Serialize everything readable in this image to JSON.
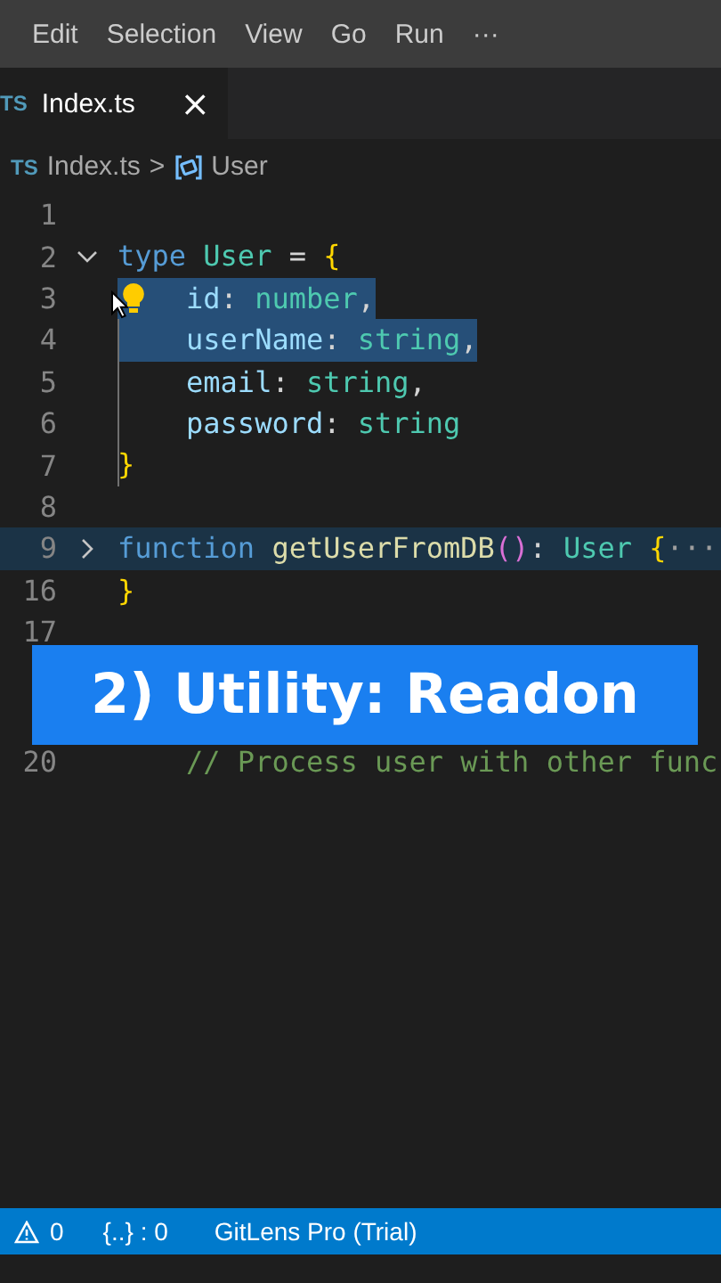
{
  "menu": {
    "items": [
      {
        "label": "Edit"
      },
      {
        "label": "Selection"
      },
      {
        "label": "View"
      },
      {
        "label": "Go"
      },
      {
        "label": "Run"
      }
    ],
    "more": "···"
  },
  "tabs": [
    {
      "icon": "TS",
      "label": "Index.ts",
      "close": "×",
      "selected": true
    }
  ],
  "breadcrumbs": {
    "file_icon": "TS",
    "file": "Index.ts",
    "separator": ">",
    "symbol": "User"
  },
  "editor": {
    "lines": [
      {
        "number": "1",
        "selected": false,
        "lightbulb": false
      },
      {
        "number": "2",
        "expanded": true,
        "selected": false,
        "lightbulb": false,
        "tokens": [
          {
            "kind": "keyword",
            "text": "type"
          },
          {
            "kind": "type",
            "text": " User"
          },
          {
            "kind": "plain",
            "text": " = "
          },
          {
            "kind": "brace",
            "text": "{"
          }
        ]
      },
      {
        "number": "3",
        "selected": true,
        "lightbulb": true,
        "tokens": [
          {
            "kind": "property",
            "text": "    id"
          },
          {
            "kind": "plain",
            "text": ": "
          },
          {
            "kind": "type",
            "text": "number"
          },
          {
            "kind": "plain",
            "text": ","
          }
        ]
      },
      {
        "number": "4",
        "selected": true,
        "lightbulb": false,
        "tokens": [
          {
            "kind": "property",
            "text": "    userName"
          },
          {
            "kind": "plain",
            "text": ": "
          },
          {
            "kind": "type",
            "text": "string"
          },
          {
            "kind": "plain",
            "text": ","
          }
        ]
      },
      {
        "number": "5",
        "selected": false,
        "lightbulb": false,
        "tokens": [
          {
            "kind": "property",
            "text": "    email"
          },
          {
            "kind": "plain",
            "text": ": "
          },
          {
            "kind": "type",
            "text": "string"
          },
          {
            "kind": "plain",
            "text": ","
          }
        ]
      },
      {
        "number": "6",
        "selected": false,
        "lightbulb": false,
        "tokens": [
          {
            "kind": "property",
            "text": "    password"
          },
          {
            "kind": "plain",
            "text": ": "
          },
          {
            "kind": "type",
            "text": "string"
          }
        ]
      },
      {
        "number": "7",
        "selected": false,
        "lightbulb": false,
        "tokens": [
          {
            "kind": "brace",
            "text": "}"
          }
        ]
      },
      {
        "number": "8",
        "selected": false,
        "lightbulb": false
      },
      {
        "number": "9",
        "expanded": false,
        "selected": false,
        "lightbulb": false,
        "tokens": [
          {
            "kind": "keyword",
            "text": "function"
          },
          {
            "kind": "function",
            "text": " getUserFromDB"
          },
          {
            "kind": "paren",
            "text": "()"
          },
          {
            "kind": "plain",
            "text": ": "
          },
          {
            "kind": "type",
            "text": "User"
          },
          {
            "kind": "brace",
            "text": " {"
          },
          {
            "kind": "ellipsis",
            "text": "···"
          }
        ]
      },
      {
        "number": "16",
        "selected": false,
        "lightbulb": false,
        "tokens": [
          {
            "kind": "brace",
            "text": "}"
          }
        ]
      },
      {
        "number": "17",
        "selected": false,
        "lightbulb": false
      },
      {
        "number": "20",
        "selected": false,
        "lightbulb": false,
        "tokens": [
          {
            "kind": "comment",
            "text": "    // Process user with other func"
          }
        ]
      }
    ]
  },
  "caption": "2) Utility: Readon",
  "status_bar": {
    "warnings": "0",
    "brackets": "{..} : 0",
    "gitlens": "GitLens Pro (Trial)"
  }
}
